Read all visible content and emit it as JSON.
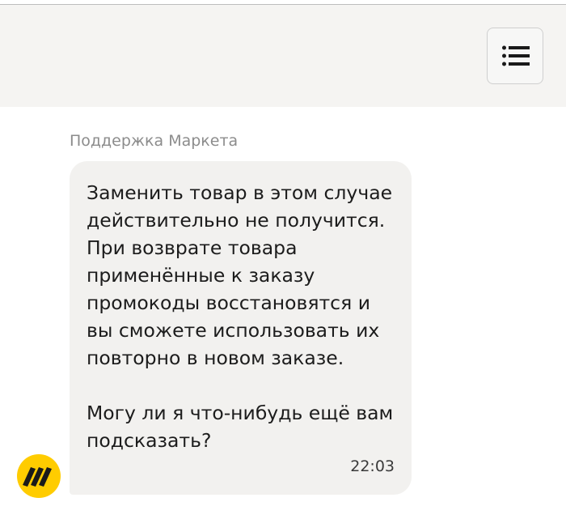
{
  "header": {
    "menu_icon": "hamburger-list-icon"
  },
  "chat": {
    "sender_name": "Поддержка Маркета",
    "message": {
      "lines": [
        "Заменить товар в этом случае",
        "действительно не получится.",
        "При возврате товара",
        "применённые к заказу",
        "промокоды восстановятся и",
        "вы сможете использовать их",
        "повторно в новом заказе.",
        "",
        "Могу ли я что-нибудь ещё вам",
        "подсказать?"
      ],
      "time": "22:03"
    },
    "avatar_icon": "yandex-market-logo-icon"
  },
  "colors": {
    "header_bg": "#f5f4f2",
    "bubble_bg": "#f2f1ef",
    "brand_yellow": "#ffcc00"
  }
}
